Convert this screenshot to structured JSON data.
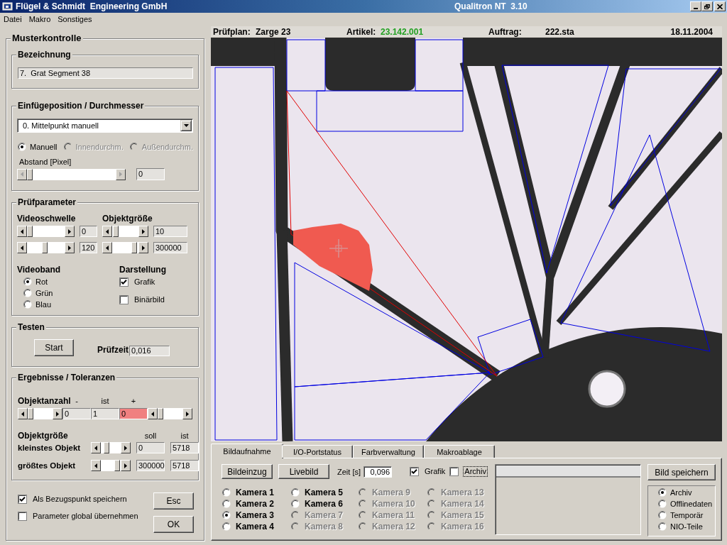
{
  "window": {
    "title": "Flügel & Schmidt  Engineering GmbH",
    "app_title": "Qualitron NT  3.10"
  },
  "menu": [
    "Datei",
    "Makro",
    "Sonstiges"
  ],
  "panel": {
    "title": "Musterkontrolle",
    "name_group": {
      "title": "Bezeichnung",
      "value": "7.  Grat Segment 38"
    },
    "position_group": {
      "title": "Einfügeposition / Durchmesser",
      "dropdown": "0. Mittelpunkt manuell",
      "modes": [
        {
          "label": "Manuell",
          "selected": true,
          "disabled": false
        },
        {
          "label": "Innendurchm.",
          "selected": false,
          "disabled": true
        },
        {
          "label": "Außendurchm.",
          "selected": false,
          "disabled": true
        }
      ],
      "distance": {
        "label": "Abstand [Pixel]",
        "level": 0,
        "disabled": true,
        "value": "0"
      }
    },
    "parameter_group": {
      "title": "Prüfparameter",
      "columns": [
        {
          "label": "Videoschwelle",
          "sliders": [
            {
              "level": 0,
              "value": "0"
            },
            {
              "level": 0.46,
              "value": "120"
            }
          ]
        },
        {
          "label": "Objektgröße",
          "sliders": [
            {
              "level": 0.05,
              "value": "10"
            },
            {
              "level": 0.93,
              "value": "300000"
            }
          ]
        }
      ],
      "videoband": {
        "label": "Videoband",
        "options": [
          {
            "label": "Rot",
            "selected": true
          },
          {
            "label": "Grün",
            "selected": false
          },
          {
            "label": "Blau",
            "selected": false
          }
        ]
      },
      "display": {
        "label": "Darstellung",
        "options": [
          {
            "label": "Grafik",
            "checked": true
          },
          {
            "label": "Binärbild",
            "checked": false
          }
        ]
      }
    },
    "test_group": {
      "title": "Testen",
      "button": "Start",
      "time_label": "Prüfzeit",
      "time_value": "0,016"
    },
    "result_group": {
      "title": "Ergebnisse / Toleranzen",
      "count": {
        "label": "Objektanzahl",
        "headers": [
          "-",
          "ist",
          "+"
        ],
        "min_slider": {
          "level": 0
        },
        "values": [
          {
            "value": "0",
            "alarm": false
          },
          {
            "value": "1",
            "alarm": false
          },
          {
            "value": "0",
            "alarm": true
          }
        ],
        "max_slider": {
          "level": 0
        }
      },
      "size": {
        "label": "Objektgröße",
        "headers": [
          "soll",
          "ist"
        ],
        "rows": [
          {
            "label": "kleinstes Objekt",
            "level": 0.19,
            "target": "0",
            "actual": "5718"
          },
          {
            "label": "größtes Objekt",
            "level": 0.95,
            "target": "300000",
            "actual": "5718"
          }
        ]
      }
    },
    "options": [
      {
        "label": "Als Bezugspunkt speichern",
        "checked": true
      },
      {
        "label": "Parameter global übernehmen",
        "checked": false
      }
    ],
    "buttons": [
      "Esc",
      "OK"
    ]
  },
  "header": {
    "fields": [
      {
        "label": "Prüfplan:",
        "value": "Zarge 23",
        "color": "#000000"
      },
      {
        "label": "Artikel:",
        "value": "23.142.001",
        "color": "#22a022"
      },
      {
        "label": "Auftrag:",
        "value": "222.sta",
        "color": "#000000"
      }
    ],
    "date": "18.11.2004"
  },
  "tabs": [
    {
      "label": "Bildaufnahme",
      "selected": true
    },
    {
      "label": "I/O-Portstatus",
      "selected": false
    },
    {
      "label": "Farbverwaltung",
      "selected": false
    },
    {
      "label": "Makroablage",
      "selected": false
    }
  ],
  "capture": {
    "buttons": [
      "Bildeinzug",
      "Livebild"
    ],
    "time": {
      "label": "Zeit [s]",
      "value": "0,096"
    },
    "checks": [
      {
        "label": "Grafik",
        "checked": true,
        "focused": false
      },
      {
        "label": "Archiv",
        "checked": false,
        "focused": true
      }
    ],
    "cameras": [
      {
        "label": "Kamera 1",
        "selected": false,
        "disabled": false
      },
      {
        "label": "Kamera 2",
        "selected": false,
        "disabled": false
      },
      {
        "label": "Kamera 3",
        "selected": true,
        "disabled": false
      },
      {
        "label": "Kamera 4",
        "selected": false,
        "disabled": false
      },
      {
        "label": "Kamera 5",
        "selected": false,
        "disabled": false
      },
      {
        "label": "Kamera 6",
        "selected": false,
        "disabled": false
      },
      {
        "label": "Kamera 7",
        "selected": false,
        "disabled": true
      },
      {
        "label": "Kamera 8",
        "selected": false,
        "disabled": true
      },
      {
        "label": "Kamera 9",
        "selected": false,
        "disabled": true
      },
      {
        "label": "Kamera 10",
        "selected": false,
        "disabled": true
      },
      {
        "label": "Kamera 11",
        "selected": false,
        "disabled": true
      },
      {
        "label": "Kamera 12",
        "selected": false,
        "disabled": true
      },
      {
        "label": "Kamera 13",
        "selected": false,
        "disabled": true
      },
      {
        "label": "Kamera 14",
        "selected": false,
        "disabled": true
      },
      {
        "label": "Kamera 15",
        "selected": false,
        "disabled": true
      },
      {
        "label": "Kamera 16",
        "selected": false,
        "disabled": true
      }
    ],
    "save_button": "Bild speichern",
    "targets": [
      {
        "label": "Archiv",
        "selected": true
      },
      {
        "label": "Offlinedaten",
        "selected": false
      },
      {
        "label": "Temporär",
        "selected": false
      },
      {
        "label": "NIO-Teile",
        "selected": false
      }
    ]
  }
}
